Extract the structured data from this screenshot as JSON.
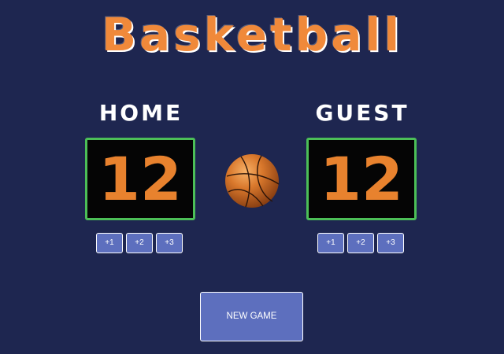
{
  "title": "Basketball",
  "home": {
    "name": "HOME",
    "score": "12",
    "buttons": [
      "+1",
      "+2",
      "+3"
    ]
  },
  "guest": {
    "name": "GUEST",
    "score": "12",
    "buttons": [
      "+1",
      "+2",
      "+3"
    ]
  },
  "new_game_label": "NEW GAME",
  "ball_icon": "basketball-icon",
  "colors": {
    "background": "#1e2650",
    "title": "#f0893a",
    "score_text": "#e8822e",
    "score_border": "#4cbf57",
    "score_bg": "#050505",
    "button": "#5d6fbe"
  }
}
